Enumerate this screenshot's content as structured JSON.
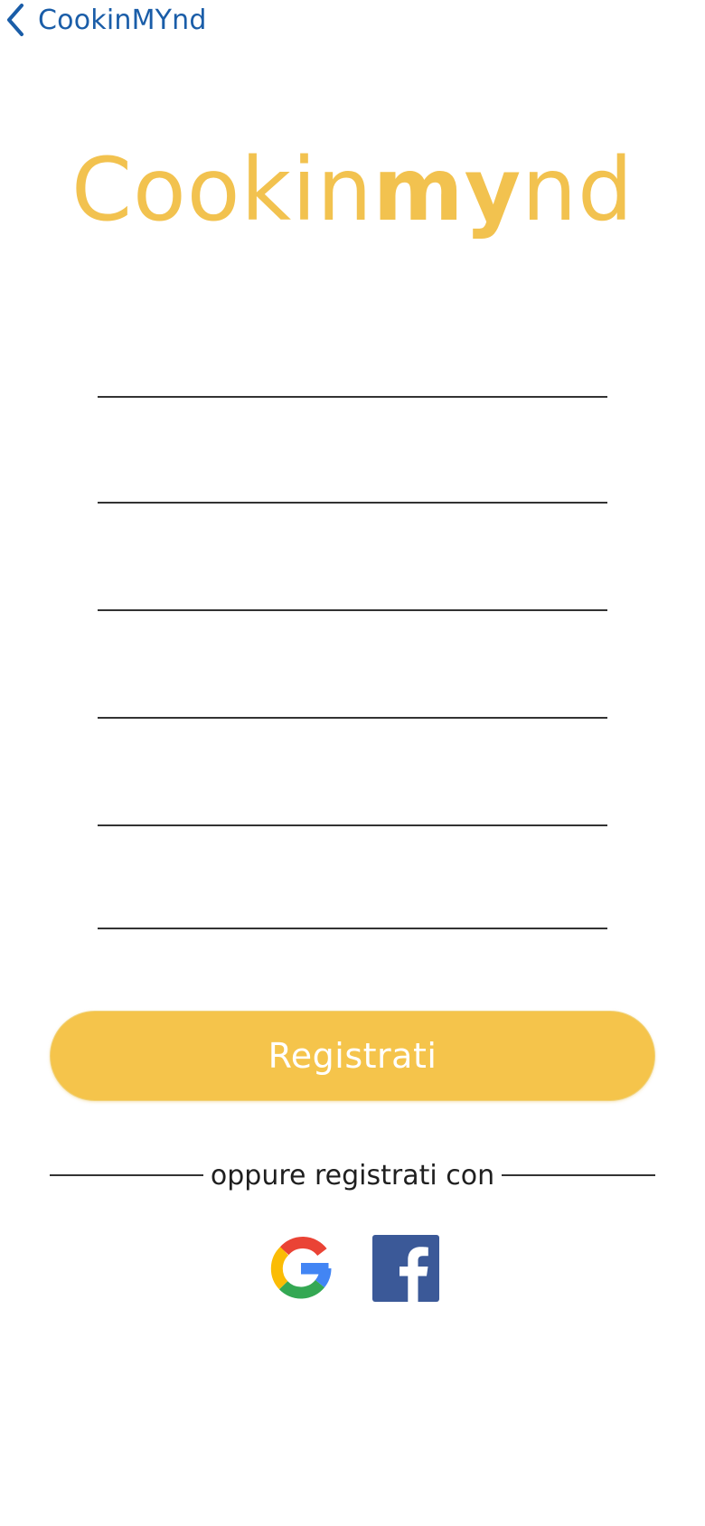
{
  "nav": {
    "back_label": "CookinMYnd",
    "back_icon": "chevron-left-icon",
    "accent_color": "#1a5da8"
  },
  "logo": {
    "text_light": "Cookin",
    "text_bold": "my",
    "text_rest": "nd",
    "color": "#f2c24f"
  },
  "form": {
    "fields": [
      {
        "value": "",
        "placeholder": ""
      },
      {
        "value": "",
        "placeholder": ""
      },
      {
        "value": "",
        "placeholder": ""
      },
      {
        "value": "",
        "placeholder": ""
      },
      {
        "value": "",
        "placeholder": ""
      },
      {
        "value": "",
        "placeholder": ""
      }
    ]
  },
  "register_button": {
    "label": "Registrati",
    "color": "#f5c44b"
  },
  "divider": {
    "text": "oppure registrati con"
  },
  "social": {
    "google_icon": "google-icon",
    "facebook_icon": "facebook-icon",
    "facebook_color": "#3b5998"
  }
}
